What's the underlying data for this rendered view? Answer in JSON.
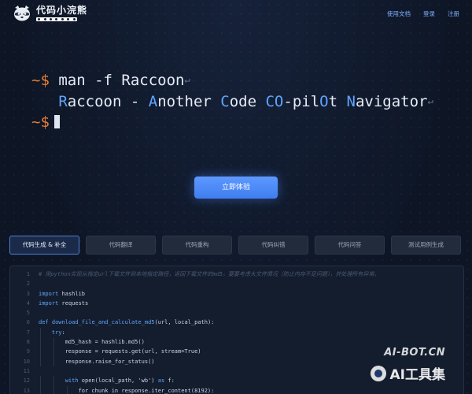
{
  "brand": {
    "name": "代码小浣熊",
    "logo": "raccoon-icon"
  },
  "nav": {
    "docs": "使用文档",
    "login": "登录",
    "register": "注册"
  },
  "terminal": {
    "line1_prompt": "~$",
    "line1_cmd": "man -f Raccoon",
    "line2_parts": [
      "R",
      "accoon - ",
      "A",
      "nother ",
      "C",
      "ode ",
      "CO",
      "-pil",
      "O",
      "t ",
      "N",
      "avigator"
    ],
    "line3_prompt": "~$",
    "newline_glyph": "↵"
  },
  "cta": {
    "label": "立即体验"
  },
  "tabs": [
    {
      "label": "代码生成 & 补全",
      "active": true
    },
    {
      "label": "代码翻译",
      "active": false
    },
    {
      "label": "代码重构",
      "active": false
    },
    {
      "label": "代码纠错",
      "active": false
    },
    {
      "label": "代码问答",
      "active": false
    },
    {
      "label": "测试用例生成",
      "active": false
    }
  ],
  "code": {
    "lines": [
      {
        "n": "1",
        "text": "# 用python实现从指定url下载文件到本地指定路径，返回下载文件的md5，要要考虑大文件情况（防止内存不足问题），并处理所有异常。",
        "kind": "comment"
      },
      {
        "n": "2",
        "text": "",
        "kind": "plain"
      },
      {
        "n": "3",
        "text": "import hashlib",
        "kind": "import"
      },
      {
        "n": "4",
        "text": "import requests",
        "kind": "import"
      },
      {
        "n": "5",
        "text": "",
        "kind": "plain"
      },
      {
        "n": "6",
        "text": "def download_file_and_calculate_md5(url, local_path):",
        "kind": "def"
      },
      {
        "n": "7",
        "text": "    try:",
        "kind": "try"
      },
      {
        "n": "8",
        "text": "        md5_hash = hashlib.md5()",
        "kind": "plain"
      },
      {
        "n": "9",
        "text": "        response = requests.get(url, stream=True)",
        "kind": "plain"
      },
      {
        "n": "10",
        "text": "        response.raise_for_status()",
        "kind": "plain"
      },
      {
        "n": "11",
        "text": "",
        "kind": "plain"
      },
      {
        "n": "12",
        "text": "        with open(local_path, 'wb') as f:",
        "kind": "with"
      },
      {
        "n": "13",
        "text": "            for chunk in response.iter_content(8192):",
        "kind": "plain"
      }
    ]
  },
  "watermark": {
    "top": "AI-BOT.CN",
    "bottom": "AI工具集"
  }
}
